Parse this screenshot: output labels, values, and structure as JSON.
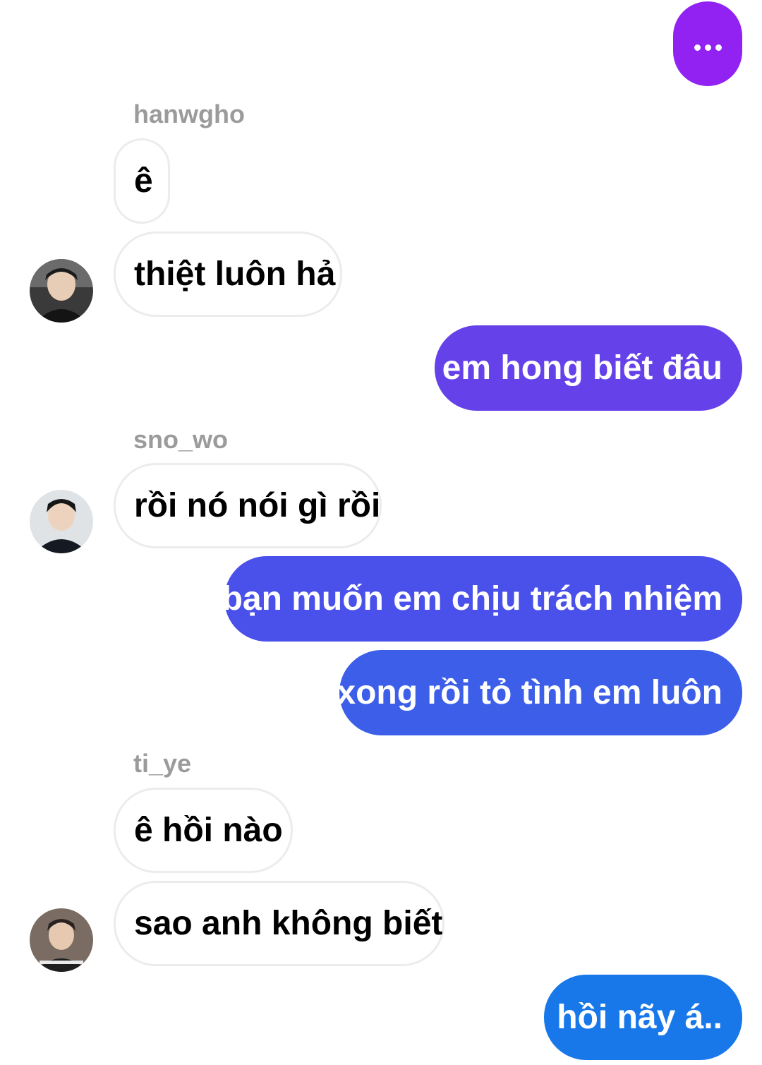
{
  "typing_indicator": {
    "label": "typing",
    "color": "#9122f2"
  },
  "messages": [
    {
      "sender": "hanwgho"
    },
    {
      "text": "ê"
    },
    {
      "text": "thiệt luôn hả"
    },
    {
      "text": "em hong biết đâu"
    },
    {
      "sender": "sno_wo"
    },
    {
      "text": "rồi nó nói gì rồi"
    },
    {
      "text": "bạn muốn em chịu trách nhiệm"
    },
    {
      "text": "xong rồi tỏ tình em luôn"
    },
    {
      "sender": "ti_ye"
    },
    {
      "text": "ê hồi nào"
    },
    {
      "text": "sao anh không biết"
    },
    {
      "text": "hồi nãy á.."
    }
  ],
  "colors": {
    "incoming_bg": "#ffffff",
    "incoming_border": "#ececec",
    "outgoing_1": "#6541ea",
    "outgoing_2": "#4a50ea",
    "outgoing_3": "#3c5ee8",
    "outgoing_4": "#1878ea",
    "sender_name": "#9b9b9b"
  }
}
